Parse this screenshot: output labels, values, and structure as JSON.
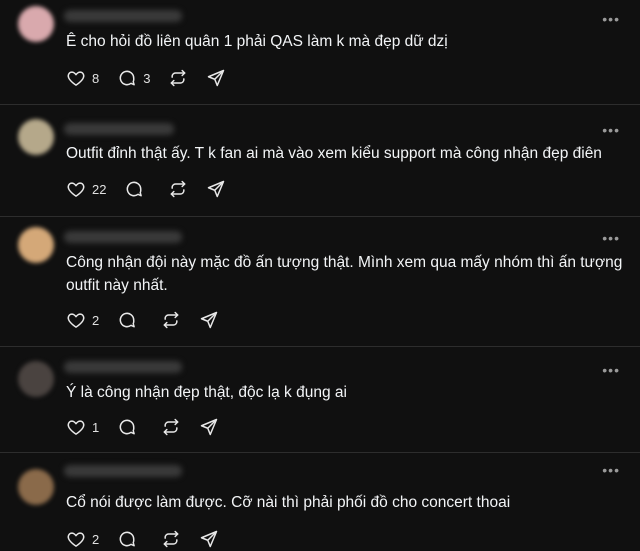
{
  "posts": [
    {
      "text": "Ê cho hỏi đồ liên quân 1 phải QAS làm k mà đẹp dữ dzị",
      "likes": "8",
      "replies": "3",
      "avatar_color": "#d9a9ad"
    },
    {
      "text": "Outfit đỉnh thật ấy. T k fan ai mà vào xem kiểu support mà công nhận đẹp điên",
      "likes": "22",
      "replies": "",
      "avatar_color": "#b5a88a"
    },
    {
      "text": "Công nhận đội này mặc đồ ấn tượng thật. Mình xem qua mấy nhóm thì ấn tượng outfit này nhất.",
      "likes": "2",
      "replies": "",
      "avatar_color": "#d4a878"
    },
    {
      "text": "Ý là công nhận đẹp thật, độc lạ k đụng ai",
      "likes": "1",
      "replies": "",
      "avatar_color": "#4a4340"
    },
    {
      "text": "Cổ nói được làm được. Cỡ nài thì phải phối đồ cho concert thoai",
      "likes": "2",
      "replies": "",
      "avatar_color": "#8a6a4a"
    }
  ],
  "more_label": "•••"
}
